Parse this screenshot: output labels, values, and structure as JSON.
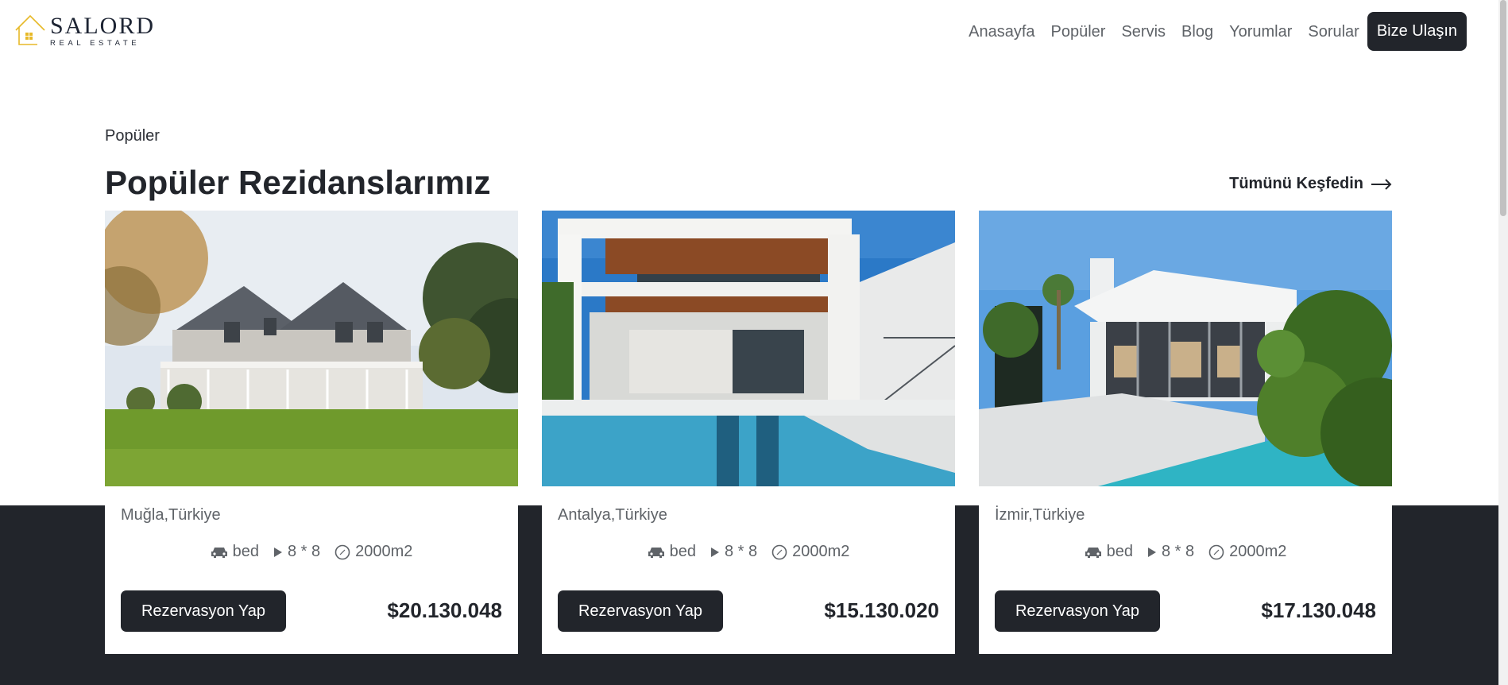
{
  "header": {
    "logo_name": "SALORD",
    "logo_sub": "REAL ESTATE",
    "nav": [
      "Anasayfa",
      "Popüler",
      "Servis",
      "Blog",
      "Yorumlar",
      "Sorular"
    ],
    "contact_label": "Bize Ulaşın"
  },
  "section": {
    "eyebrow": "Popüler",
    "title": "Popüler Rezidanslarımız",
    "explore_label": "Tümünü Keşfedin"
  },
  "cards": [
    {
      "location": "Muğla,Türkiye",
      "bed": "bed",
      "size": "8 * 8",
      "area": "2000m2",
      "button": "Rezervasyon Yap",
      "price": "$20.130.048"
    },
    {
      "location": "Antalya,Türkiye",
      "bed": "bed",
      "size": "8 * 8",
      "area": "2000m2",
      "button": "Rezervasyon Yap",
      "price": "$15.130.020"
    },
    {
      "location": "İzmir,Türkiye",
      "bed": "bed",
      "size": "8 * 8",
      "area": "2000m2",
      "button": "Rezervasyon Yap",
      "price": "$17.130.048"
    }
  ],
  "colors": {
    "dark": "#22252b",
    "accent_logo": "#e7b928",
    "muted_text": "#5f6368"
  },
  "icons": [
    "house-logo-icon",
    "arrow-right-icon",
    "car-icon",
    "play-icon",
    "compass-icon"
  ]
}
